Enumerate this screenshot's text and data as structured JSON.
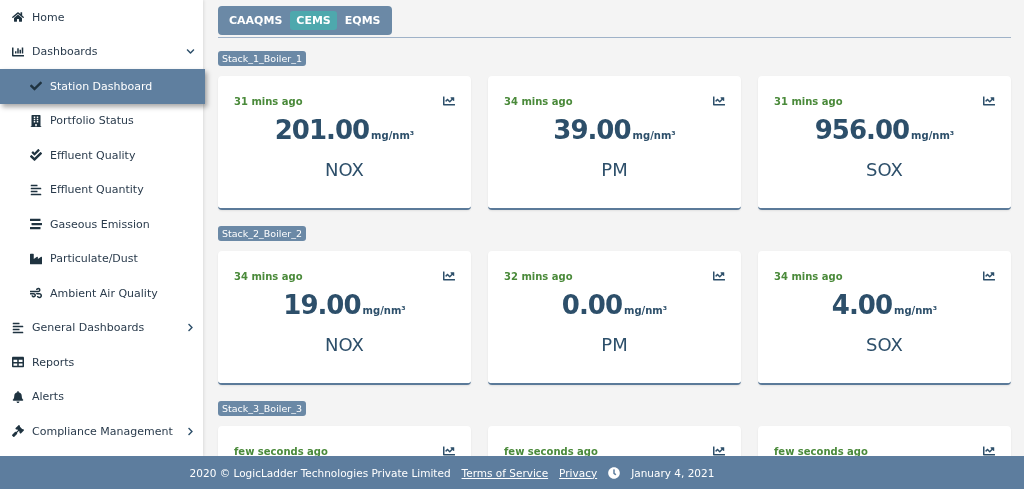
{
  "sidebar": {
    "items": [
      {
        "label": "Home",
        "selected": false
      },
      {
        "label": "Dashboards",
        "selected": false,
        "expanded": true,
        "children": [
          {
            "label": "Station Dashboard",
            "selected": true
          },
          {
            "label": "Portfolio Status",
            "selected": false
          },
          {
            "label": "Effluent Quality",
            "selected": false
          },
          {
            "label": "Effluent Quantity",
            "selected": false
          },
          {
            "label": "Gaseous Emission",
            "selected": false
          },
          {
            "label": "Particulate/Dust",
            "selected": false
          },
          {
            "label": "Ambient Air Quality",
            "selected": false
          }
        ]
      },
      {
        "label": "General Dashboards",
        "selected": false,
        "expanded": false
      },
      {
        "label": "Reports",
        "selected": false
      },
      {
        "label": "Alerts",
        "selected": false
      },
      {
        "label": "Compliance Management",
        "selected": false,
        "expanded": false
      }
    ]
  },
  "tabs": [
    {
      "label": "CAAQMS",
      "selected": false
    },
    {
      "label": "CEMS",
      "selected": true
    },
    {
      "label": "EQMS",
      "selected": false
    }
  ],
  "sections": [
    {
      "title": "Stack_1_Boiler_1",
      "cards": [
        {
          "time": "31 mins ago",
          "value": "201.00",
          "unit": "mg/nm³",
          "parameter": "NOX"
        },
        {
          "time": "34 mins ago",
          "value": "39.00",
          "unit": "mg/nm³",
          "parameter": "PM"
        },
        {
          "time": "31 mins ago",
          "value": "956.00",
          "unit": "mg/nm³",
          "parameter": "SOX"
        }
      ]
    },
    {
      "title": "Stack_2_Boiler_2",
      "cards": [
        {
          "time": "34 mins ago",
          "value": "19.00",
          "unit": "mg/nm³",
          "parameter": "NOX"
        },
        {
          "time": "32 mins ago",
          "value": "0.00",
          "unit": "mg/nm³",
          "parameter": "PM"
        },
        {
          "time": "34 mins ago",
          "value": "4.00",
          "unit": "mg/nm³",
          "parameter": "SOX"
        }
      ]
    },
    {
      "title": "Stack_3_Boiler_3",
      "cards": [
        {
          "time": "few seconds ago"
        },
        {
          "time": "few seconds ago"
        },
        {
          "time": "few seconds ago"
        }
      ]
    }
  ],
  "footer": {
    "copyright": "2020 © LogicLadder Technologies Private Limited",
    "links": [
      "Terms of Service",
      "Privacy"
    ],
    "date": "January 4, 2021"
  }
}
